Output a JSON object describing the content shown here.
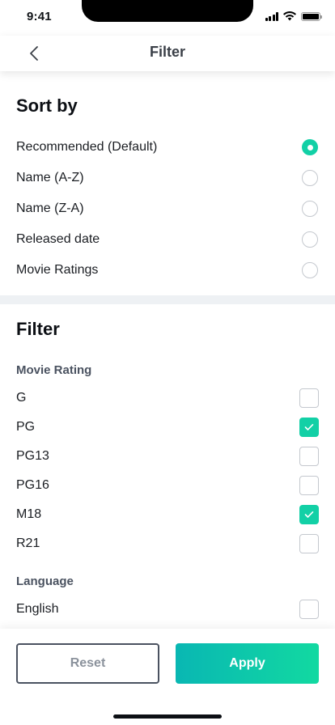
{
  "status_bar": {
    "time": "9:41"
  },
  "nav": {
    "title": "Filter",
    "back_icon": "chevron-left-icon"
  },
  "sort": {
    "title": "Sort by",
    "options": [
      {
        "label": "Recommended (Default)",
        "selected": true
      },
      {
        "label": "Name (A-Z)",
        "selected": false
      },
      {
        "label": "Name (Z-A)",
        "selected": false
      },
      {
        "label": "Released date",
        "selected": false
      },
      {
        "label": "Movie Ratings",
        "selected": false
      }
    ]
  },
  "filter": {
    "title": "Filter",
    "rating_group": {
      "title": "Movie Rating",
      "options": [
        {
          "label": "G",
          "checked": false
        },
        {
          "label": "PG",
          "checked": true
        },
        {
          "label": "PG13",
          "checked": false
        },
        {
          "label": "PG16",
          "checked": false
        },
        {
          "label": "M18",
          "checked": true
        },
        {
          "label": "R21",
          "checked": false
        }
      ]
    },
    "language_group": {
      "title": "Language",
      "options": [
        {
          "label": "English",
          "checked": false
        }
      ]
    }
  },
  "footer": {
    "reset_label": "Reset",
    "apply_label": "Apply"
  },
  "colors": {
    "accent": "#12d0a6",
    "accent_start": "#09b7b3",
    "accent_end": "#12d9a1"
  }
}
